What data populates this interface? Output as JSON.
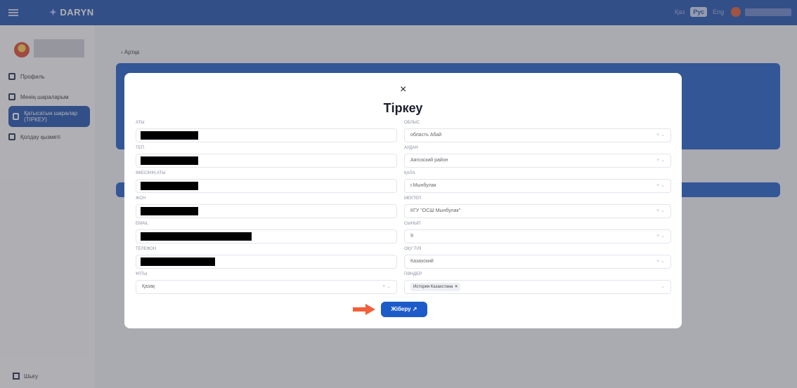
{
  "topbar": {
    "logo": "DARYN",
    "languages": [
      {
        "label": "Қаз",
        "active": false
      },
      {
        "label": "Рус",
        "active": true
      },
      {
        "label": "Eng",
        "active": false
      }
    ]
  },
  "sidebar": {
    "items": [
      {
        "label": "Профиль",
        "icon": "user-icon"
      },
      {
        "label": "Менің шараларым",
        "icon": "calendar-icon"
      },
      {
        "label": "Қатысатын шаралар (ТІРКЕУ)",
        "icon": "clipboard-icon",
        "active": true
      },
      {
        "label": "Қолдау қызметі",
        "icon": "support-icon"
      }
    ],
    "logout": "Шығу"
  },
  "main": {
    "back": "Артқа"
  },
  "modal": {
    "close": "×",
    "title": "Тіркеу",
    "left_fields": [
      {
        "label": "АТЫ",
        "value": ""
      },
      {
        "label": "ТЕГІ",
        "value": ""
      },
      {
        "label": "ӘКЕСІНІҢ АТЫ",
        "value": ""
      },
      {
        "label": "ЖСН",
        "value": ""
      },
      {
        "label": "EMAIL",
        "value": ""
      },
      {
        "label": "ТЕЛЕФОН",
        "value": ""
      },
      {
        "label": "ҰЛТЫ",
        "value": "Қазақ"
      }
    ],
    "right_fields": [
      {
        "label": "ОБЛЫС",
        "value": "область Абай"
      },
      {
        "label": "АУДАН",
        "value": "Аягозский район"
      },
      {
        "label": "ҚАЛА",
        "value": "г.Мынбулак"
      },
      {
        "label": "МЕКТЕП",
        "value": "КГУ \"ОСШ Мынбулак\""
      },
      {
        "label": "СЫНЫП",
        "value": "9"
      },
      {
        "label": "ОҚУ ТІЛІ",
        "value": "Казахский"
      },
      {
        "label": "ПӘНДЕР",
        "value": "История Казахстана"
      }
    ],
    "submit": "Жіберу ↗"
  },
  "colors": {
    "primary": "#1d4fae",
    "accent_arrow": "#f0603a"
  }
}
